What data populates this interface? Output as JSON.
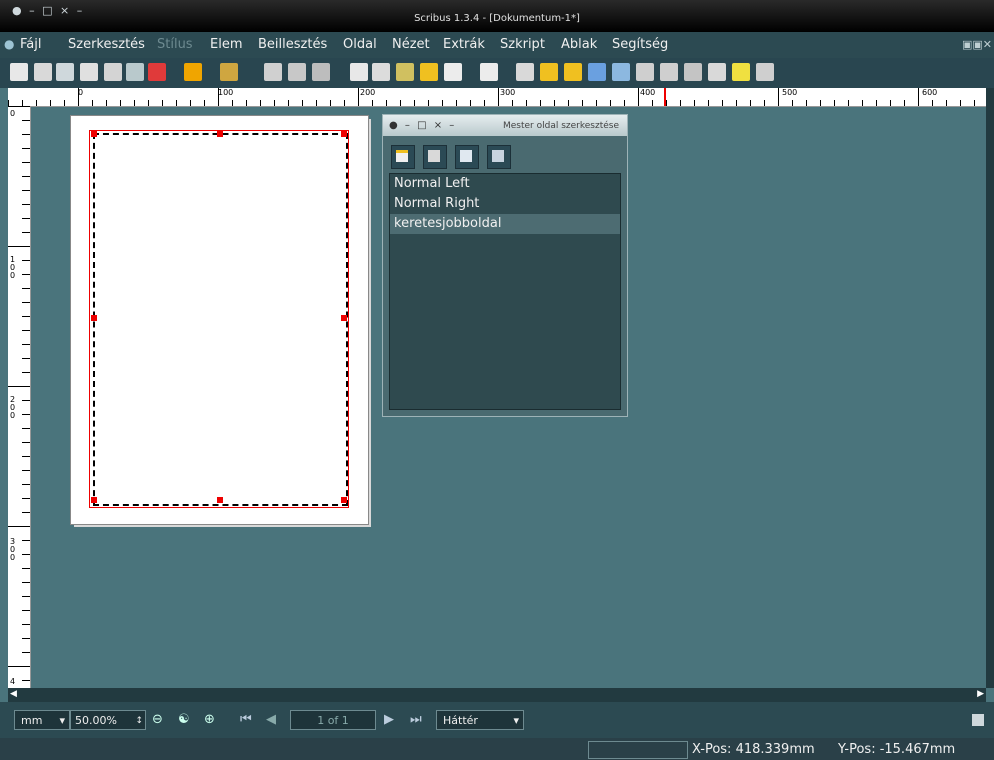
{
  "window": {
    "title": "Scribus 1.3.4 - [Dokumentum-1*]",
    "wm_controls": "● – □ × –"
  },
  "menu": {
    "items": [
      {
        "label": "Fájl",
        "enabled": true
      },
      {
        "label": "Szerkesztés",
        "enabled": true
      },
      {
        "label": "Stílus",
        "enabled": false
      },
      {
        "label": "Elem",
        "enabled": true
      },
      {
        "label": "Beillesztés",
        "enabled": true
      },
      {
        "label": "Oldal",
        "enabled": true
      },
      {
        "label": "Nézet",
        "enabled": true
      },
      {
        "label": "Extrák",
        "enabled": true
      },
      {
        "label": "Szkript",
        "enabled": true
      },
      {
        "label": "Ablak",
        "enabled": true
      },
      {
        "label": "Segítség",
        "enabled": true
      }
    ],
    "window_controls": "▣▣✕"
  },
  "toolbar": {
    "icons": [
      "new-document-icon",
      "open-icon",
      "save-icon",
      "close-icon",
      "print-icon",
      "preflight-icon",
      "pdf-export-icon",
      "undo-icon",
      "redo-icon",
      "cut-icon",
      "copy-icon",
      "paste-icon",
      "select-icon",
      "text-frame-icon",
      "image-frame-icon",
      "table-icon",
      "shape-icon",
      "polygon-icon",
      "line-icon",
      "bezier-icon",
      "freehand-icon",
      "rotate-icon",
      "zoom-icon",
      "edit-contents-icon",
      "link-frames-icon",
      "unlink-frames-icon",
      "measure-icon",
      "copy-properties-icon",
      "eyedropper-icon"
    ]
  },
  "ruler": {
    "h_labels": [
      "0",
      "100",
      "200",
      "300",
      "400",
      "500",
      "600"
    ],
    "v_labels": [
      [
        "0"
      ],
      [
        "1",
        "0",
        "0"
      ],
      [
        "2",
        "0",
        "0"
      ],
      [
        "3",
        "0",
        "0"
      ],
      [
        "4"
      ]
    ]
  },
  "master_dialog": {
    "title": "Mester oldal szerkesztése",
    "wm_controls": "● – □ × –",
    "buttons": [
      "new-master-icon",
      "duplicate-master-icon",
      "import-master-icon",
      "delete-master-icon"
    ],
    "items": [
      "Normal Left",
      "Normal Right",
      "keretesjobboldal"
    ],
    "selected_index": 2
  },
  "bottom": {
    "unit": "mm",
    "zoom": "50.00%",
    "page_indicator": "1 of 1",
    "layer": "Háttér"
  },
  "status": {
    "xpos": "X-Pos: 418.339mm",
    "ypos": "Y-Pos: -15.467mm"
  },
  "colors": {
    "menubar": "#2c4a52",
    "canvas": "#4a747c",
    "red_margin": "#e00000"
  }
}
